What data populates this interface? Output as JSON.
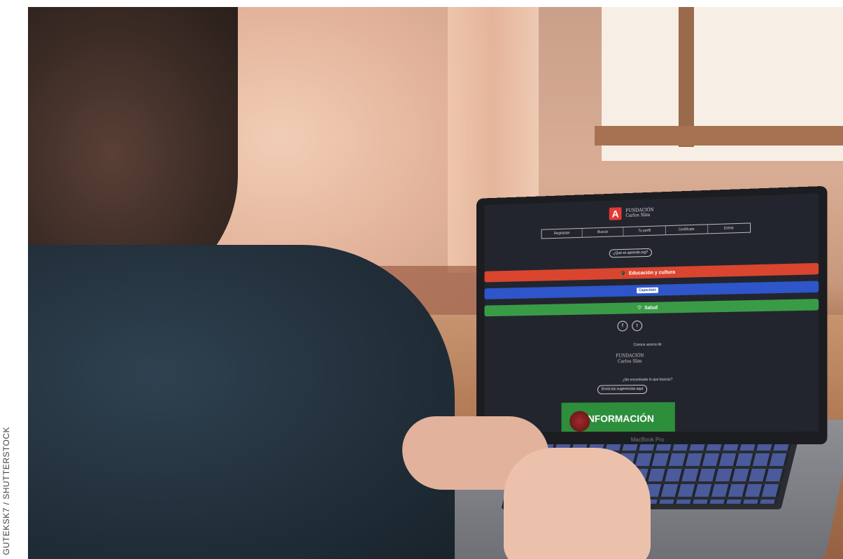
{
  "credit": "GUTEKSK7 / SHUTTERSTOCK",
  "screen": {
    "logo_letter": "A",
    "logo_line1": "FUNDACIÓN",
    "logo_line2": "Carlos Slim",
    "nav": [
      "Regístrate",
      "Buscar",
      "Tu perfil",
      "Certifícate",
      "Entrar"
    ],
    "what_button": "¿Qué es aprende.org?",
    "band_education": "Educación y cultura",
    "band_capacitate": "Capacítate",
    "band_health": "Salud",
    "social_facebook": "f",
    "social_twitter": "t",
    "know_more": "Conoce acerca de",
    "foundation_line1": "FUNDACIÓN",
    "foundation_line2": "Carlos Slim",
    "not_found": "¿No encontraste lo que buscas?",
    "suggest_button": "Envía tus sugerencias aquí",
    "info_banner": "INFORMACIÓN",
    "device_label": "MacBook Pro"
  },
  "colors": {
    "red_band": "#d9452f",
    "blue_band": "#2e55c9",
    "green_band": "#3a9b47",
    "screen_bg": "#22252d"
  }
}
